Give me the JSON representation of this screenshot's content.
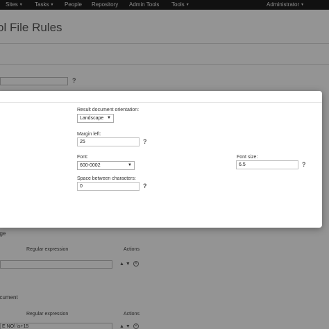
{
  "nav": {
    "items": [
      {
        "label": "Sites",
        "has_menu": true
      },
      {
        "label": "Tasks",
        "has_menu": true
      },
      {
        "label": "People",
        "has_menu": false
      },
      {
        "label": "Repository",
        "has_menu": false
      },
      {
        "label": "Admin Tools",
        "has_menu": false
      },
      {
        "label": "Tools",
        "has_menu": true
      }
    ],
    "user": "Administrator",
    "caret_glyph": "▼"
  },
  "page": {
    "title": "ol File Rules",
    "help_glyph": "?",
    "sections": [
      {
        "title": "age",
        "col_regex": "Regular expression",
        "col_actions": "Actions",
        "row_value": "",
        "action_up": "▲",
        "action_down": "▼",
        "action_remove": "×"
      },
      {
        "title": "ocument",
        "col_regex": "Regular expression",
        "col_actions": "Actions",
        "row_value": "E NO\\ \\s+15",
        "action_up": "▲",
        "action_down": "▼",
        "action_remove": "×"
      }
    ]
  },
  "modal": {
    "orientation": {
      "label": "Result document orientation:",
      "value": "Landscape"
    },
    "margin_left": {
      "label": "Margin left:",
      "value": "25"
    },
    "font": {
      "label": "Font:",
      "value": "600-0002"
    },
    "font_size": {
      "label": "Font size:",
      "value": "6.5"
    },
    "char_spacing": {
      "label": "Space between characters:",
      "value": "0"
    },
    "help_glyph": "?",
    "select_caret": "▼"
  },
  "colors": {
    "navbar": "#1e1e1e",
    "overlay": "rgba(0,0,0,0.42)"
  }
}
